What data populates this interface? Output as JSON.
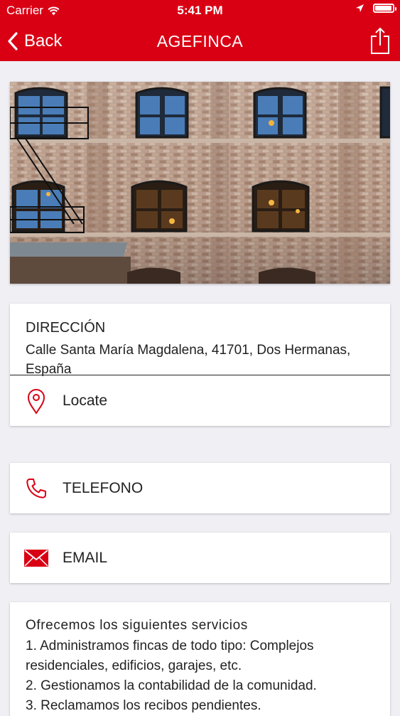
{
  "status_bar": {
    "carrier": "Carrier",
    "time": "5:41 PM",
    "battery_level": 0.95
  },
  "nav": {
    "back_label": "Back",
    "title": "AGEFINCA"
  },
  "address": {
    "label": "DIRECCIÓN",
    "text": "Calle Santa María Magdalena, 41701, Dos Hermanas, España"
  },
  "locate": {
    "label": "Locate"
  },
  "phone": {
    "label": "TELEFONO"
  },
  "email": {
    "label": "EMAIL"
  },
  "services": {
    "heading": "Ofrecemos los siguientes servicios",
    "items": [
      "1. Administramos fincas de todo tipo: Complejos residenciales, edificios, garajes, etc.",
      "2. Gestionamos la contabilidad de la comunidad.",
      "3. Reclamamos los recibos pendientes."
    ]
  },
  "colors": {
    "accent": "#d90014",
    "background": "#efeff4"
  }
}
